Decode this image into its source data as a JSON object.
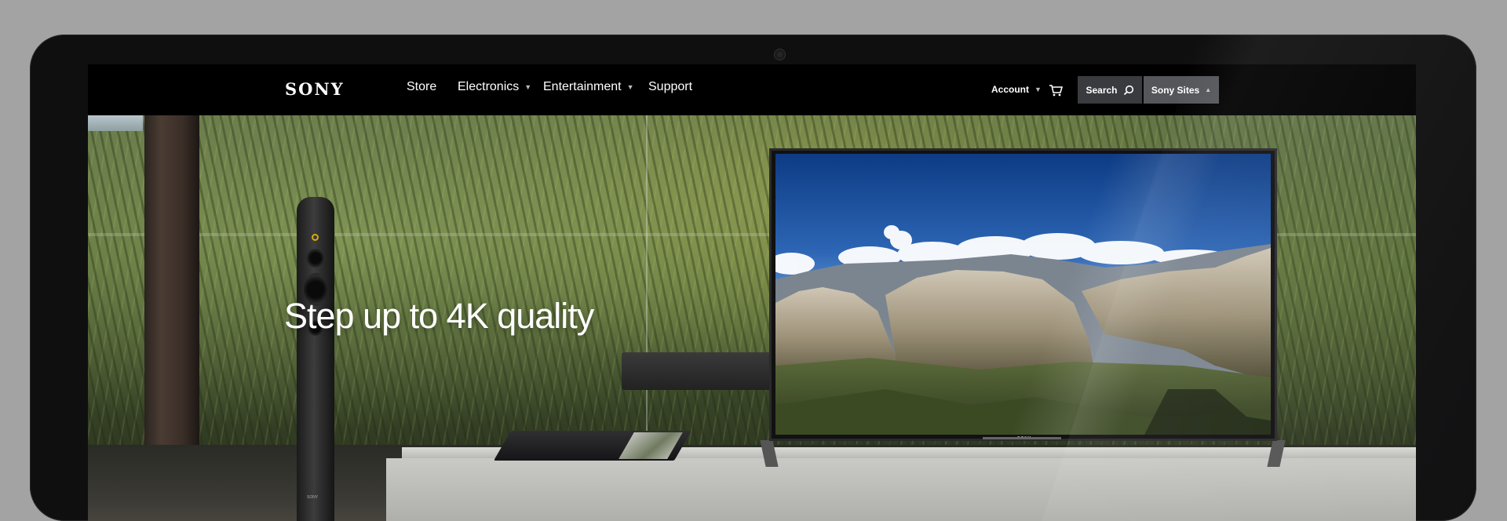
{
  "brand": {
    "logo": "SONY"
  },
  "nav": {
    "items": [
      {
        "label": "Store",
        "has_dropdown": false
      },
      {
        "label": "Electronics",
        "has_dropdown": true
      },
      {
        "label": "Entertainment",
        "has_dropdown": true
      },
      {
        "label": "Support",
        "has_dropdown": false
      }
    ],
    "account": {
      "label": "Account",
      "has_dropdown": true
    },
    "cart": {
      "icon": "cart-icon"
    },
    "search": {
      "label": "Search",
      "icon": "search-icon"
    },
    "sony_sites": {
      "label": "Sony Sites",
      "has_dropdown": true
    }
  },
  "hero": {
    "headline": "Step up to 4K quality",
    "tv_logo": "SONY",
    "speaker_label": "SONY"
  },
  "colors": {
    "nav_background": "#000000",
    "search_button": "#3a3b3e",
    "sony_sites_button": "#54565a",
    "bezel": "#0f0f10",
    "background": "#a3a3a3"
  }
}
